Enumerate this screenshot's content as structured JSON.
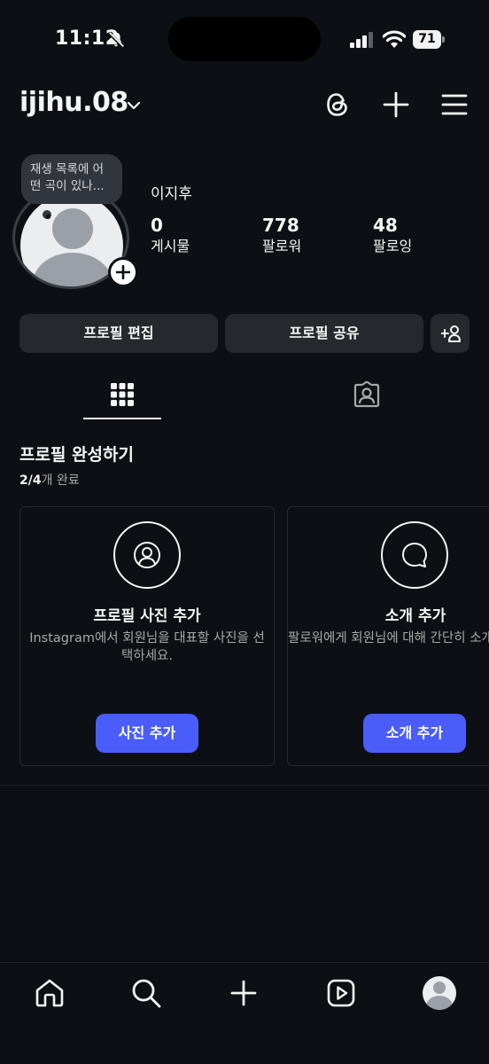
{
  "status_bar": {
    "time": "11:12",
    "battery": "71",
    "icons": [
      "bell-slash-icon",
      "signal-icon",
      "wifi-icon",
      "battery-icon"
    ]
  },
  "header": {
    "username": "ijihu.08",
    "icons": [
      "chevron-down-icon",
      "threads-icon",
      "plus-icon",
      "menu-icon"
    ]
  },
  "profile": {
    "note": "재생 목록에 어떤 곡이 있나...",
    "display_name": "이지후",
    "stats": [
      {
        "value": "0",
        "label": "게시물"
      },
      {
        "value": "778",
        "label": "팔로워"
      },
      {
        "value": "48",
        "label": "팔로잉"
      }
    ]
  },
  "actions": {
    "edit_profile": "프로필 편집",
    "share_profile": "프로필 공유"
  },
  "tabs": [
    {
      "icon": "grid-icon",
      "active": true
    },
    {
      "icon": "tagged-icon",
      "active": false
    }
  ],
  "complete_profile": {
    "title": "프로필 완성하기",
    "progress_done": "2/4",
    "progress_suffix": "개 완료",
    "cards": [
      {
        "icon": "person-circle-icon",
        "title": "프로필 사진 추가",
        "description": "Instagram에서 회원님을 대표할 사진을 선택하세요.",
        "button": "사진 추가"
      },
      {
        "icon": "speech-bubble-icon",
        "title": "소개 추가",
        "description": "팔로워에게 회원님에 대해 간단히 소개해주세요.",
        "button": "소개 추가"
      }
    ]
  },
  "bottom_nav": [
    "home-icon",
    "search-icon",
    "create-icon",
    "reels-icon",
    "profile-avatar"
  ],
  "colors": {
    "background": "#0c1014",
    "button_bg": "#25292e",
    "accent": "#4a5df9",
    "secondary_text": "#a8a8a8"
  }
}
